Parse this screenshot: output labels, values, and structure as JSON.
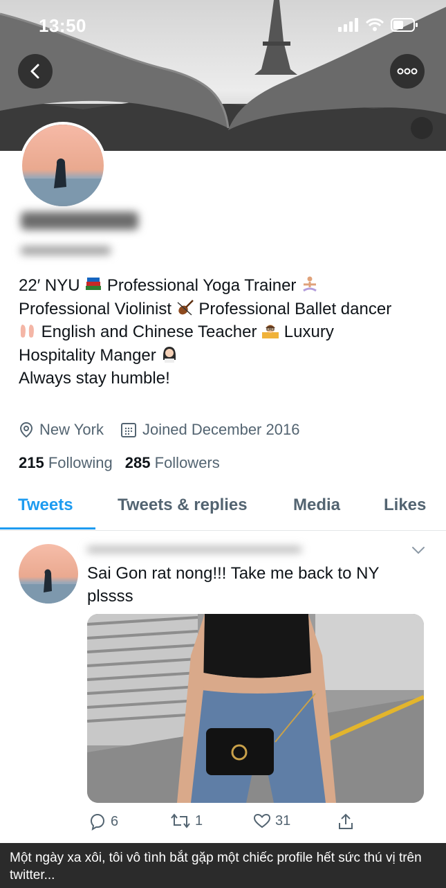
{
  "status_bar": {
    "time": "13:50"
  },
  "bio": {
    "line1": "22′ NYU",
    "seg_yoga": "Professional Yoga Trainer",
    "seg_violin": "Professional Violinist",
    "seg_ballet": "Professional Ballet dancer",
    "seg_teacher": "English and Chinese Teacher",
    "seg_luxury": "Luxury",
    "seg_hospitality": "Hospitality Manger",
    "seg_humble": "Always stay humble!"
  },
  "meta": {
    "location": "New York",
    "joined": "Joined December 2016"
  },
  "stats": {
    "following_count": "215",
    "following_label": "Following",
    "followers_count": "285",
    "followers_label": "Followers"
  },
  "tabs": [
    {
      "label": "Tweets"
    },
    {
      "label": "Tweets & replies"
    },
    {
      "label": "Media"
    },
    {
      "label": "Likes"
    }
  ],
  "tweet": {
    "text": "Sai Gon rat nong!!! Take me back to NY plssss",
    "replies": "6",
    "retweets": "1",
    "likes": "31"
  },
  "caption": "Một ngày xa xôi, tôi vô tình bắt gặp một chiếc profile hết sức thú vị trên twitter...",
  "colors": {
    "accent": "#1d9bf0",
    "text": "#0f1419",
    "muted": "#536471",
    "caption_bg": "#2b2b2b"
  }
}
